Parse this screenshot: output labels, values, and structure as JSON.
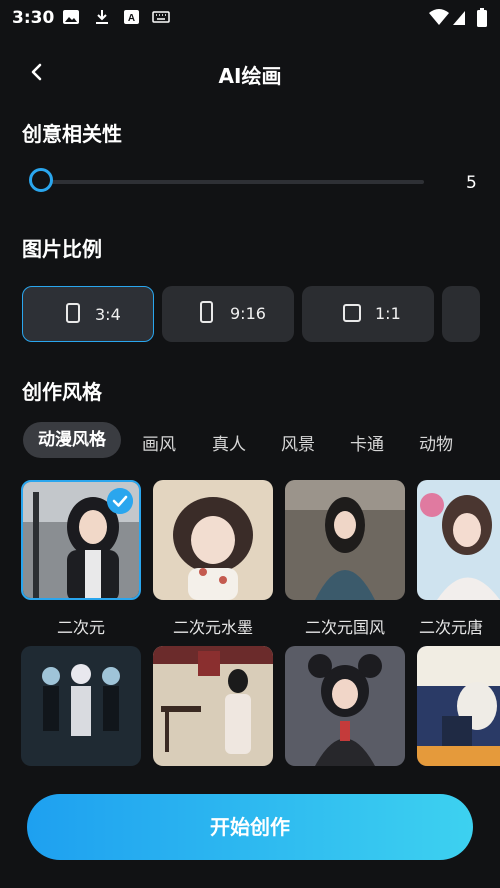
{
  "status": {
    "time": "3:30"
  },
  "header": {
    "title": "AI绘画"
  },
  "creativity": {
    "title": "创意相关性",
    "value": "5"
  },
  "ratio": {
    "title": "图片比例",
    "options": [
      {
        "label": "3:4"
      },
      {
        "label": "9:16"
      },
      {
        "label": "1:1"
      }
    ]
  },
  "style": {
    "title": "创作风格",
    "tabs": [
      "动漫风格",
      "画风",
      "真人",
      "风景",
      "卡通",
      "动物"
    ],
    "items_row1": [
      "二次元",
      "二次元水墨",
      "二次元国风",
      "二次元唐"
    ]
  },
  "action": {
    "start_label": "开始创作"
  },
  "colors": {
    "accent": "#2aa6ee",
    "background": "#111214",
    "card": "#2b2d31"
  }
}
